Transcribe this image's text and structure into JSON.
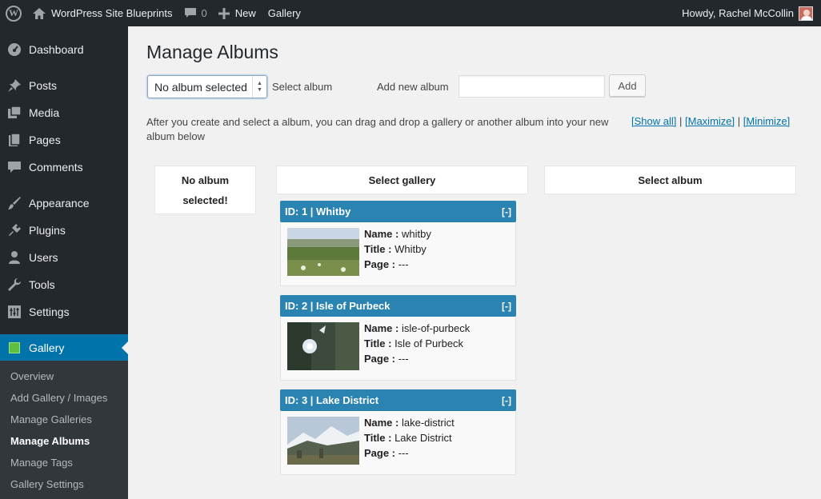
{
  "admin_bar": {
    "site_name": "WordPress Site Blueprints",
    "comments_count": "0",
    "new_label": "New",
    "gallery_label": "Gallery",
    "howdy": "Howdy, Rachel McCollin"
  },
  "sidebar": {
    "items": [
      {
        "label": "Dashboard",
        "icon": "dashboard-icon"
      },
      {
        "label": "Posts",
        "icon": "pin-icon"
      },
      {
        "label": "Media",
        "icon": "media-icon"
      },
      {
        "label": "Pages",
        "icon": "pages-icon"
      },
      {
        "label": "Comments",
        "icon": "comment-icon"
      },
      {
        "label": "Appearance",
        "icon": "brush-icon"
      },
      {
        "label": "Plugins",
        "icon": "plug-icon"
      },
      {
        "label": "Users",
        "icon": "user-icon"
      },
      {
        "label": "Tools",
        "icon": "wrench-icon"
      },
      {
        "label": "Settings",
        "icon": "settings-icon"
      },
      {
        "label": "Gallery",
        "icon": "gallery-icon"
      }
    ],
    "submenu": [
      "Overview",
      "Add Gallery / Images",
      "Manage Galleries",
      "Manage Albums",
      "Manage Tags",
      "Gallery Settings"
    ]
  },
  "page": {
    "title": "Manage Albums",
    "album_select_value": "No album selected",
    "select_album_label": "Select album",
    "add_new_label": "Add new album",
    "add_button": "Add",
    "description": "After you create and select a album, you can drag and drop a gallery or another album into your new album below",
    "show_all": "[Show all]",
    "maximize": "[Maximize]",
    "minimize": "[Minimize]",
    "separator": "|",
    "no_album_box": "No album selected!",
    "select_gallery_header": "Select gallery",
    "select_album_header": "Select album"
  },
  "galleries": [
    {
      "header": "ID: 1 | Whitby",
      "toggle": "[-]",
      "name_label": "Name :",
      "name": "whitby",
      "title_label": "Title :",
      "title": "Whitby",
      "page_label": "Page :",
      "page": "---"
    },
    {
      "header": "ID: 2 | Isle of Purbeck",
      "toggle": "[-]",
      "name_label": "Name :",
      "name": "isle-of-purbeck",
      "title_label": "Title :",
      "title": "Isle of Purbeck",
      "page_label": "Page :",
      "page": "---"
    },
    {
      "header": "ID: 3 | Lake District",
      "toggle": "[-]",
      "name_label": "Name :",
      "name": "lake-district",
      "title_label": "Title :",
      "title": "Lake District",
      "page_label": "Page :",
      "page": "---"
    }
  ],
  "colors": {
    "admin_dark": "#23282d",
    "accent_blue": "#0073aa",
    "card_header": "#2b83b1"
  }
}
